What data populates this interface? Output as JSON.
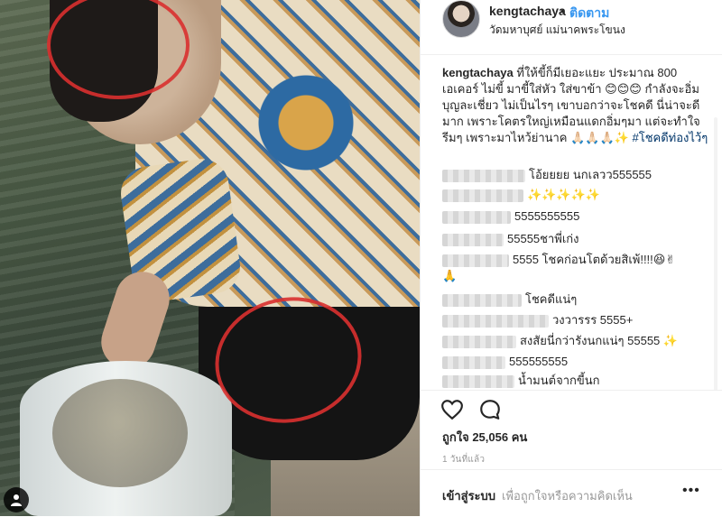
{
  "post": {
    "username": "kengtachaya",
    "separator": "•",
    "follow_label": "ติดตาม",
    "location": "วัดมหาบุศย์ แม่นาคพระโขนง"
  },
  "caption": {
    "username": "kengtachaya",
    "text": " ที่ให้ขี้ก็มีเยอะแยะ ประมาณ 800 เอเคอร์ ไม่ขี้ มาขี้ใส่หัว ใส่ขาข้า 😊😊😊 กำลังจะอิ่มบุญละเชี่ยว ไม่เป็นไรๆ เขาบอกว่าจะโชคดี นี่น่าจะดีมาก เพราะโคตรใหญ่เหมือนแดกอิ่มๆมา แต่จะทำใจรีมๆ เพราะมาไหว้ย่านาค 🙏🏻🙏🏻🙏🏻✨",
    "hashtag": "#โชคดีท่องไว้ๆ"
  },
  "comments": [
    {
      "text": "โอ้ยยยย นกเลวว555555"
    },
    {
      "text": "✨✨✨✨✨"
    },
    {
      "text": "5555555555"
    },
    {
      "text": "55555ชาพี่เก่ง"
    },
    {
      "text": "5555 โชคก่อนโตด้วยสิเพ้!!!!😆✌"
    },
    {
      "text": "🙏"
    },
    {
      "text": "โชคดีแน่ๆ"
    },
    {
      "text": "วงวารรร 5555+"
    },
    {
      "text": "สงสัยนี่กว่ารังนกแน่ๆ 55555 ✨"
    },
    {
      "text": "555555555"
    },
    {
      "text": "น้ำมนต์จากขี้นก"
    }
  ],
  "actions": {
    "like_icon": "heart-outline-icon",
    "comment_icon": "speech-bubble-icon"
  },
  "likes_label": "ถูกใจ 25,056 คน",
  "time_ago": "1 วันที่แล้ว",
  "add_comment": {
    "login_label": "เข้าสู่ระบบ",
    "hint": "เพื่อถูกใจหรือความคิดเห็น",
    "more_label": "•••"
  }
}
